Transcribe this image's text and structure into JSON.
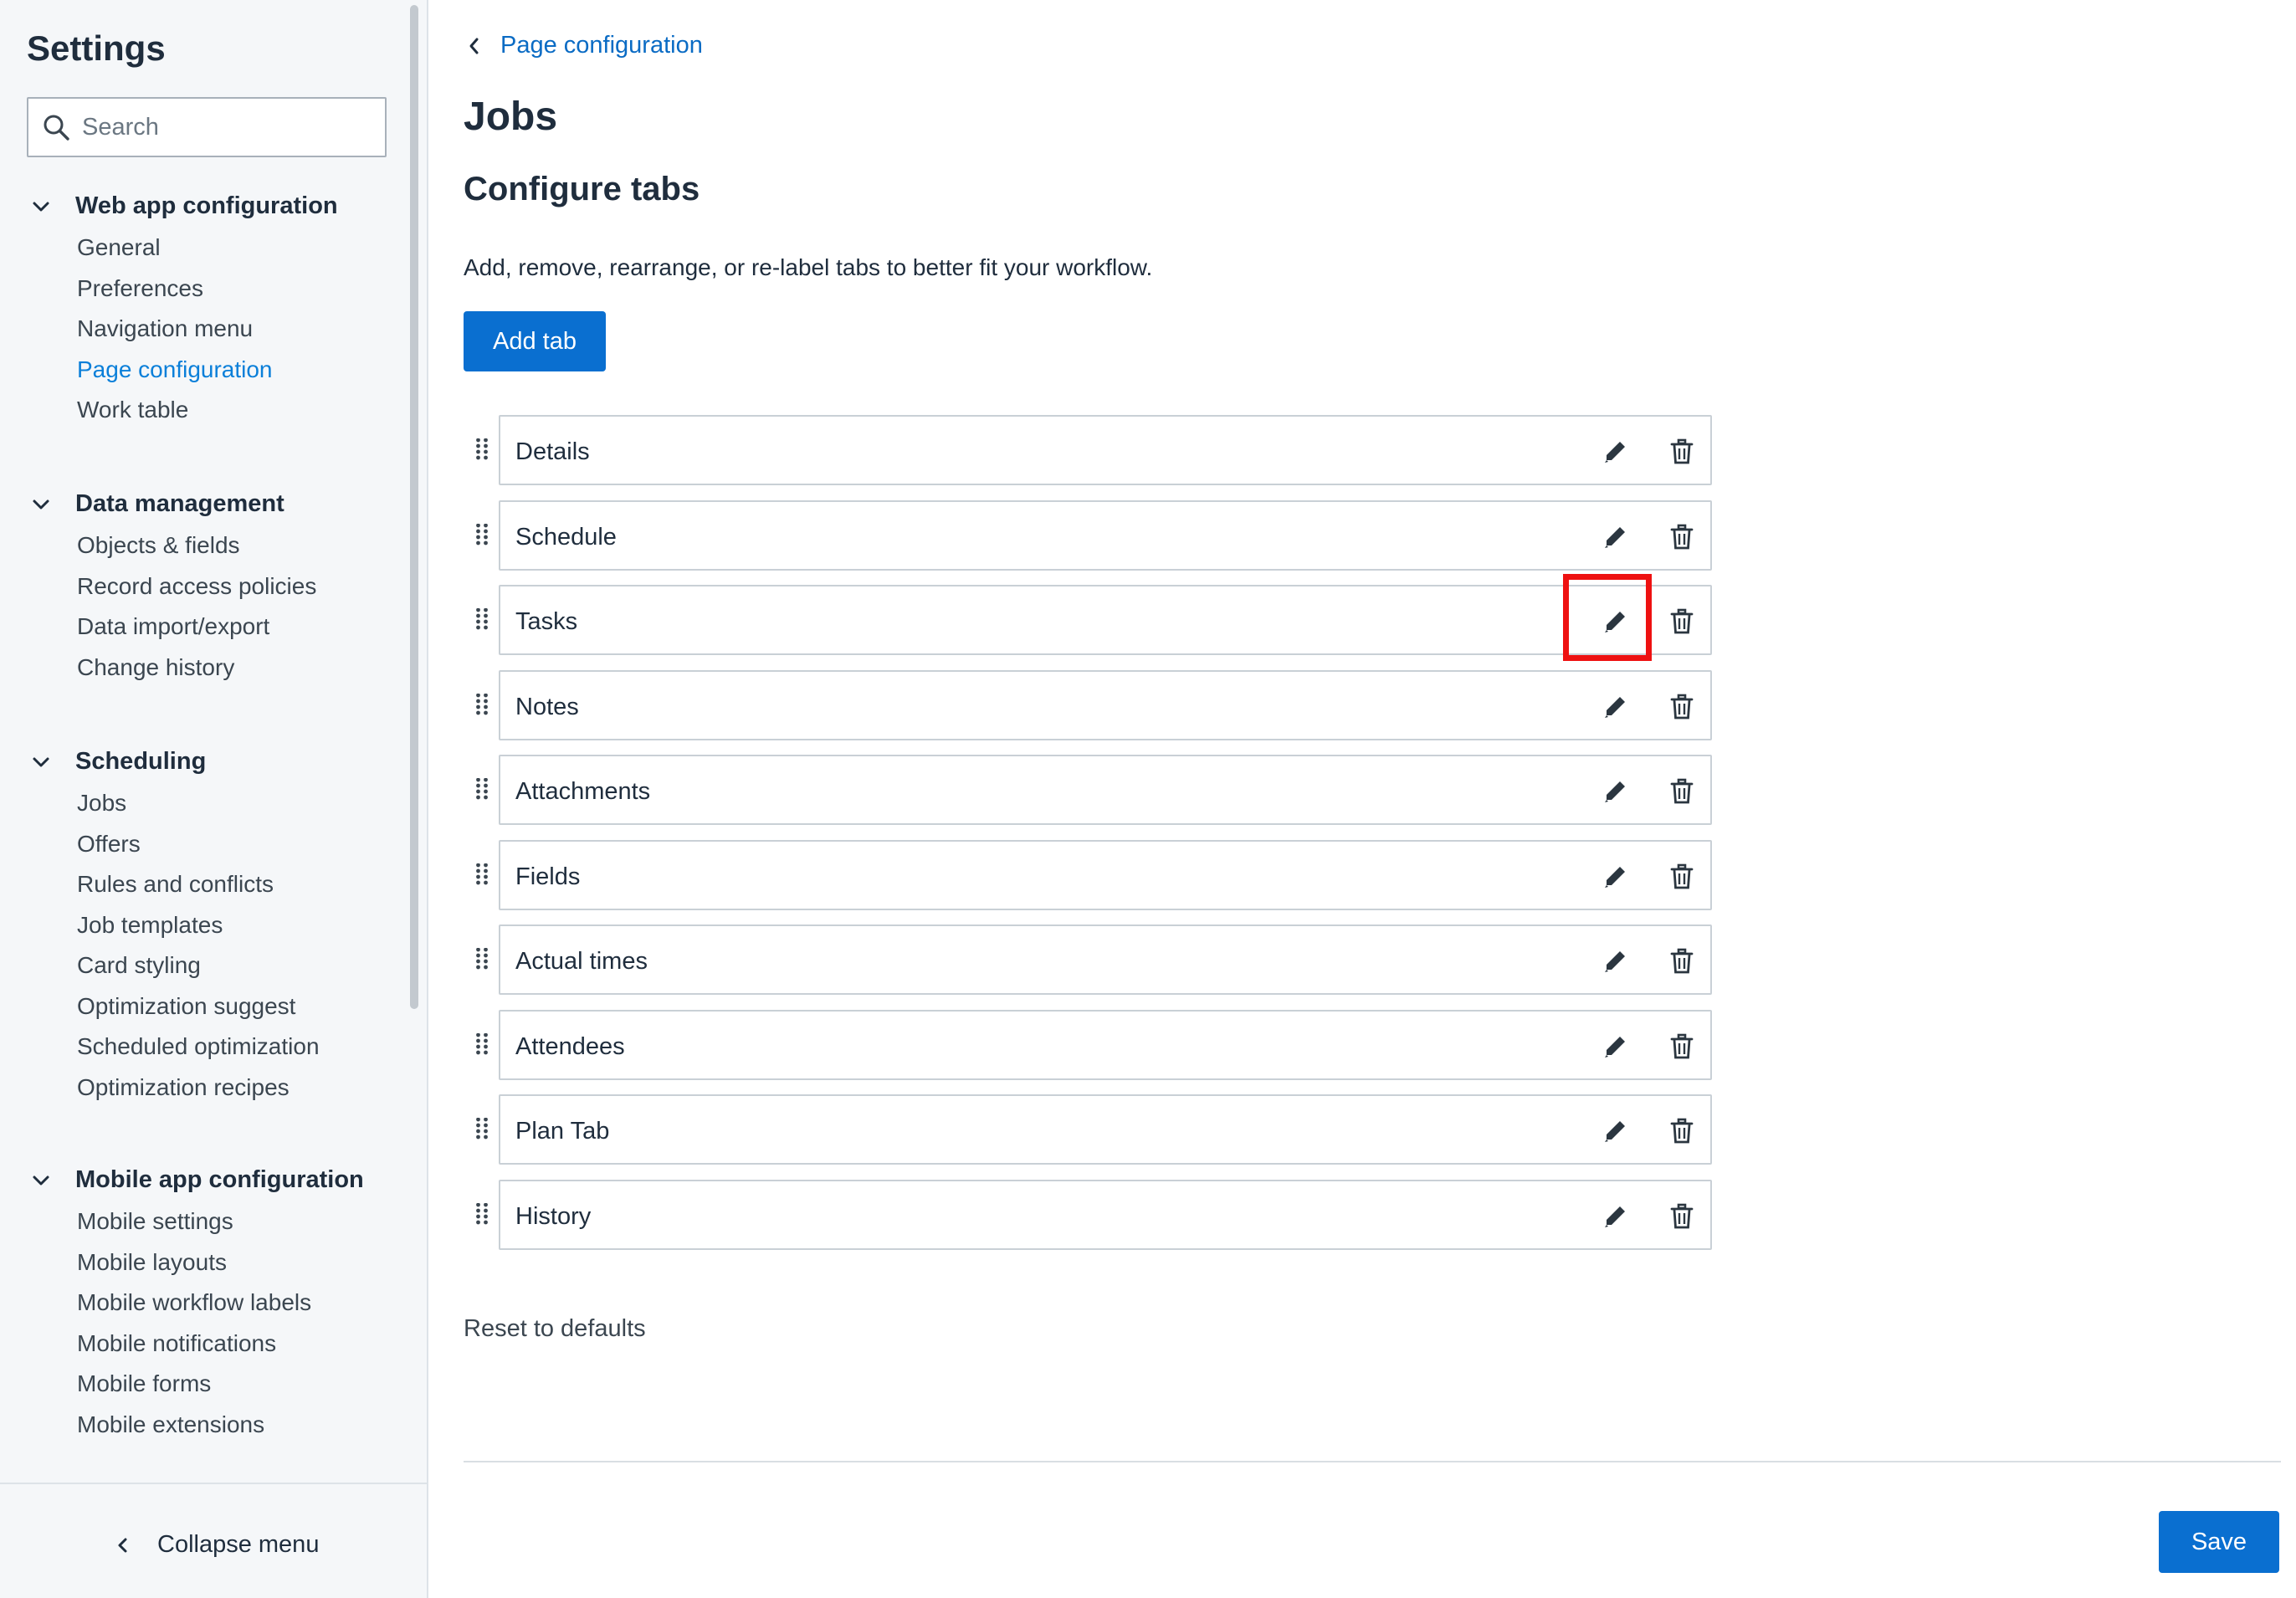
{
  "sidebar": {
    "title": "Settings",
    "search_placeholder": "Search",
    "sections": [
      {
        "label": "Web app configuration",
        "items": [
          "General",
          "Preferences",
          "Navigation menu",
          "Page configuration",
          "Work table"
        ]
      },
      {
        "label": "Data management",
        "items": [
          "Objects & fields",
          "Record access policies",
          "Data import/export",
          "Change history"
        ]
      },
      {
        "label": "Scheduling",
        "items": [
          "Jobs",
          "Offers",
          "Rules and conflicts",
          "Job templates",
          "Card styling",
          "Optimization suggest",
          "Scheduled optimization",
          "Optimization recipes"
        ]
      },
      {
        "label": "Mobile app configuration",
        "items": [
          "Mobile settings",
          "Mobile layouts",
          "Mobile workflow labels",
          "Mobile notifications",
          "Mobile forms",
          "Mobile extensions"
        ]
      }
    ],
    "active_item": "Page configuration",
    "collapse_label": "Collapse menu"
  },
  "main": {
    "breadcrumb": "Page configuration",
    "page_title": "Jobs",
    "section_title": "Configure tabs",
    "description": "Add, remove, rearrange, or re-label tabs to better fit your workflow.",
    "add_tab_label": "Add tab",
    "tabs": [
      "Details",
      "Schedule",
      "Tasks",
      "Notes",
      "Attachments",
      "Fields",
      "Actual times",
      "Attendees",
      "Plan Tab",
      "History"
    ],
    "reset_label": "Reset to defaults",
    "save_label": "Save"
  },
  "colors": {
    "accent": "#0a6fd0",
    "active_link": "#0a7fd9",
    "highlight": "#ee1111"
  },
  "icons": {
    "search": "search-icon",
    "chevron_down": "chevron-down-icon",
    "chevron_left": "chevron-left-icon",
    "drag": "drag-handle-icon",
    "edit": "pencil-icon",
    "delete": "trash-icon"
  }
}
